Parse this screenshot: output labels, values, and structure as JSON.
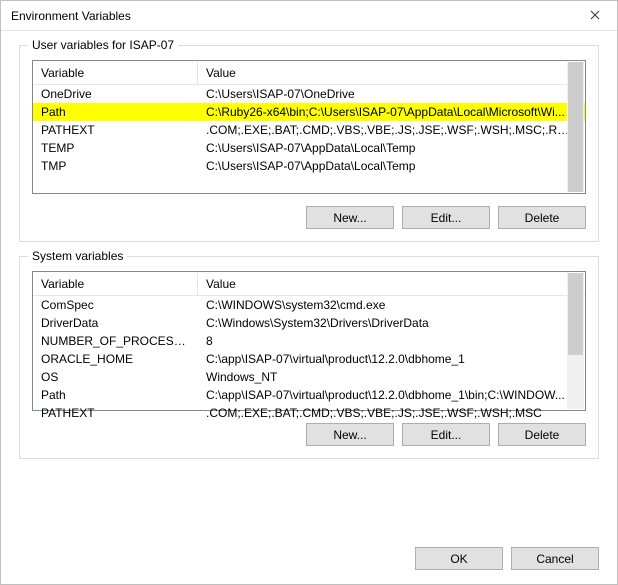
{
  "window": {
    "title": "Environment Variables"
  },
  "user_group": {
    "legend": "User variables for ISAP-07",
    "columns": {
      "variable": "Variable",
      "value": "Value"
    },
    "rows": [
      {
        "variable": "OneDrive",
        "value": "C:\\Users\\ISAP-07\\OneDrive",
        "highlight": false
      },
      {
        "variable": "Path",
        "value": "C:\\Ruby26-x64\\bin;C:\\Users\\ISAP-07\\AppData\\Local\\Microsoft\\Wi...",
        "highlight": true
      },
      {
        "variable": "PATHEXT",
        "value": ".COM;.EXE;.BAT;.CMD;.VBS;.VBE;.JS;.JSE;.WSF;.WSH;.MSC;.RB;.RBW;...",
        "highlight": false
      },
      {
        "variable": "TEMP",
        "value": "C:\\Users\\ISAP-07\\AppData\\Local\\Temp",
        "highlight": false
      },
      {
        "variable": "TMP",
        "value": "C:\\Users\\ISAP-07\\AppData\\Local\\Temp",
        "highlight": false
      }
    ],
    "buttons": {
      "new": "New...",
      "edit": "Edit...",
      "delete": "Delete"
    }
  },
  "sys_group": {
    "legend": "System variables",
    "columns": {
      "variable": "Variable",
      "value": "Value"
    },
    "rows": [
      {
        "variable": "ComSpec",
        "value": "C:\\WINDOWS\\system32\\cmd.exe"
      },
      {
        "variable": "DriverData",
        "value": "C:\\Windows\\System32\\Drivers\\DriverData"
      },
      {
        "variable": "NUMBER_OF_PROCESSORS",
        "value": "8"
      },
      {
        "variable": "ORACLE_HOME",
        "value": "C:\\app\\ISAP-07\\virtual\\product\\12.2.0\\dbhome_1"
      },
      {
        "variable": "OS",
        "value": "Windows_NT"
      },
      {
        "variable": "Path",
        "value": "C:\\app\\ISAP-07\\virtual\\product\\12.2.0\\dbhome_1\\bin;C:\\WINDOW..."
      },
      {
        "variable": "PATHEXT",
        "value": ".COM;.EXE;.BAT;.CMD;.VBS;.VBE;.JS;.JSE;.WSF;.WSH;.MSC"
      }
    ],
    "buttons": {
      "new": "New...",
      "edit": "Edit...",
      "delete": "Delete"
    }
  },
  "footer": {
    "ok": "OK",
    "cancel": "Cancel"
  }
}
